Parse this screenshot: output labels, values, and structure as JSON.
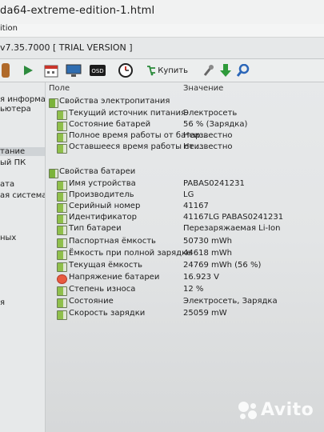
{
  "window": {
    "title": "da64-extreme-edition-1.html",
    "menu": "ition",
    "version": "v7.35.7000  [ TRIAL VERSION ]"
  },
  "toolbar": {
    "buy_label": "Купить"
  },
  "icons": {
    "list": "list-icon",
    "play": "play-icon",
    "calendar": "calendar-icon",
    "monitor": "monitor-icon",
    "osd": "osd-icon",
    "clock": "clock-icon",
    "cart": "cart-icon",
    "wrench": "wrench-icon",
    "download": "download-icon",
    "search": "search-icon"
  },
  "colors": {
    "accent": "#2a8a3a",
    "selection": "#cfd3d6",
    "text": "#1e1e1e"
  },
  "sidebar": {
    "items": [
      "я информац",
      "ьютера",
      "тание",
      "ый ПК",
      "ата",
      "ая система",
      "ных",
      "я"
    ]
  },
  "columns": {
    "field": "Поле",
    "value": "Значение"
  },
  "power": {
    "section": "Свойства электропитания",
    "rows": [
      {
        "name": "Текущий источник питания",
        "value": "Электросеть"
      },
      {
        "name": "Состояние батарей",
        "value": "56 % (Зарядка)"
      },
      {
        "name": "Полное время работы от батар...",
        "value": "Неизвестно"
      },
      {
        "name": "Оставшееся время работы от ...",
        "value": "Неизвестно"
      }
    ]
  },
  "battery": {
    "section": "Свойства батареи",
    "rows": [
      {
        "name": "Имя устройства",
        "value": "PABAS0241231"
      },
      {
        "name": "Производитель",
        "value": "LG"
      },
      {
        "name": "Серийный номер",
        "value": "41167"
      },
      {
        "name": "Идентификатор",
        "value": "41167LG PABAS0241231"
      },
      {
        "name": "Тип батареи",
        "value": "Перезаряжаемая Li-Ion"
      },
      {
        "name": "Паспортная ёмкость",
        "value": "50730 mWh"
      },
      {
        "name": "Ёмкость при полной зарядке",
        "value": "44618 mWh"
      },
      {
        "name": "Текущая ёмкость",
        "value": "24769 mWh  (56 %)"
      },
      {
        "name": "Напряжение батареи",
        "value": "16.923 V"
      },
      {
        "name": "Степень износа",
        "value": "12 %"
      },
      {
        "name": "Состояние",
        "value": "Электросеть, Зарядка"
      },
      {
        "name": "Скорость зарядки",
        "value": "25059 mW"
      }
    ]
  },
  "watermark": "Avito"
}
